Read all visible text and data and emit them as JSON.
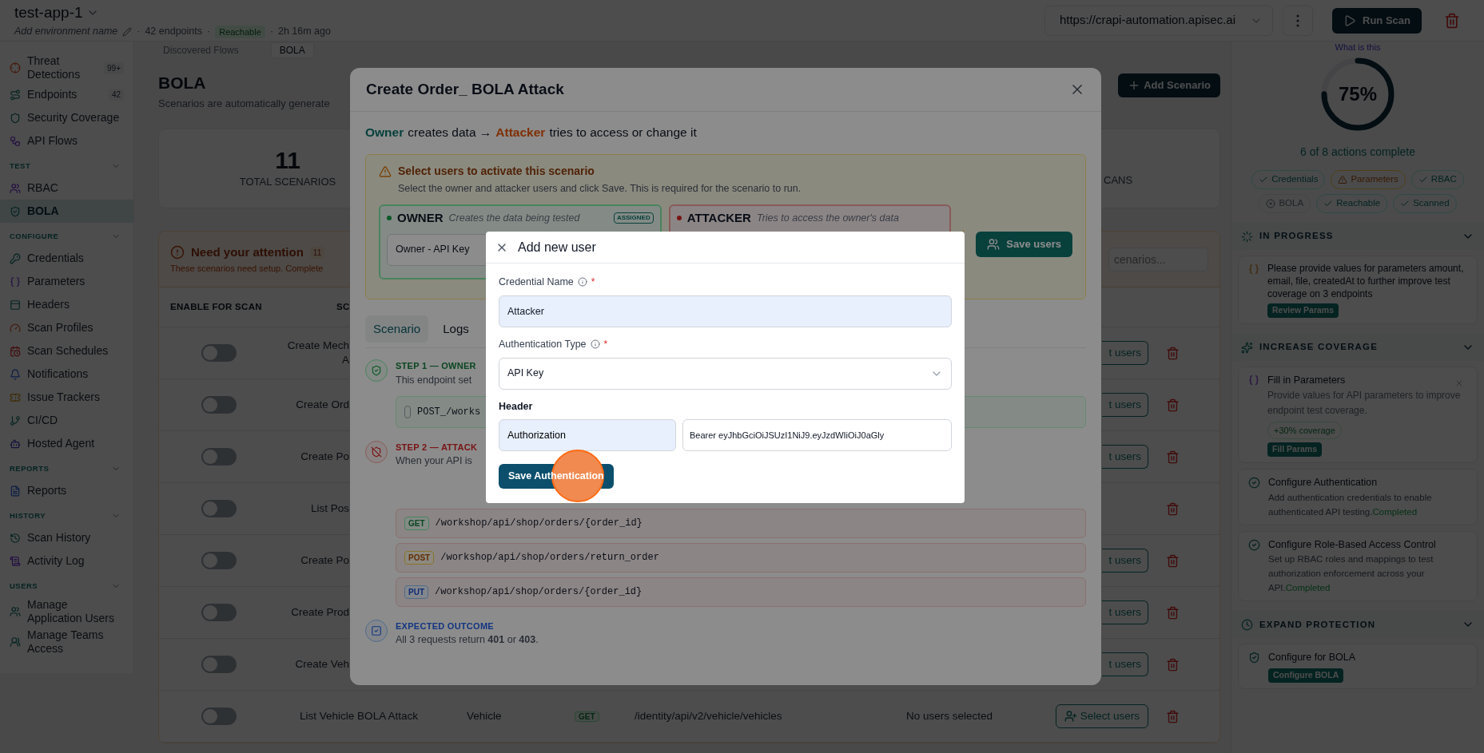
{
  "header": {
    "separator": "·",
    "app_name": "test-app-1",
    "env_placeholder": "Add environment name",
    "endpoints": "42 endpoints",
    "status": "Reachable",
    "updated": "2h 16m ago",
    "url": "https://crapi-automation.apisec.ai",
    "run_button": "Run Scan"
  },
  "sidebar": {
    "sections": [
      {
        "items": [
          {
            "label": "Threat Detections",
            "badge": "99+",
            "selected": false
          },
          {
            "label": "Endpoints",
            "badge": "42",
            "selected": false
          },
          {
            "label": "Security Coverage",
            "selected": false
          },
          {
            "label": "API Flows",
            "selected": false
          }
        ]
      },
      {
        "title": "TEST",
        "items": [
          {
            "label": "RBAC",
            "selected": false
          },
          {
            "label": "BOLA",
            "selected": true
          }
        ]
      },
      {
        "title": "CONFIGURE",
        "items": [
          {
            "label": "Credentials",
            "selected": false
          },
          {
            "label": "Parameters",
            "selected": false
          },
          {
            "label": "Headers",
            "selected": false
          },
          {
            "label": "Scan Profiles",
            "selected": false
          },
          {
            "label": "Scan Schedules",
            "selected": false
          },
          {
            "label": "Notifications",
            "selected": false
          },
          {
            "label": "Issue Trackers",
            "selected": false
          },
          {
            "label": "CI/CD",
            "selected": false
          },
          {
            "label": "Hosted Agent",
            "selected": false
          }
        ]
      },
      {
        "title": "REPORTS",
        "items": [
          {
            "label": "Reports",
            "selected": false
          }
        ]
      },
      {
        "title": "HISTORY",
        "items": [
          {
            "label": "Scan History",
            "selected": false
          },
          {
            "label": "Activity Log",
            "selected": false
          }
        ]
      },
      {
        "title": "USERS",
        "items": [
          {
            "label": "Manage Application Users",
            "selected": false
          },
          {
            "label": "Manage Teams Access",
            "selected": false
          }
        ]
      }
    ]
  },
  "page_tabs": [
    {
      "label": "Discovered Flows",
      "selected": false
    },
    {
      "label": "BOLA",
      "selected": true
    }
  ],
  "page": {
    "title": "BOLA",
    "subtitle": "Scenarios are automatically generate",
    "add_button": "Add Scenario",
    "stats": [
      {
        "value": "11",
        "label": "TOTAL SCENARIOS"
      },
      {
        "label": "CANS"
      }
    ]
  },
  "attention": {
    "title": "Need your attention",
    "count": "11",
    "text": "These scenarios need setup. Complete",
    "search_placeholder": "cenarios...",
    "columns": [
      "ENABLE FOR SCAN",
      "SC"
    ],
    "rows": [
      {
        "kind": "partial",
        "enabled": false,
        "name": [
          "Create Mech",
          "A"
        ],
        "select_users": "t users"
      },
      {
        "kind": "partial",
        "enabled": false,
        "name": [
          "Create Ord"
        ],
        "select_users": "t users"
      },
      {
        "kind": "partial",
        "enabled": false,
        "name": [
          "Create Po"
        ],
        "select_users": "t users"
      },
      {
        "kind": "partial",
        "enabled": false,
        "name": [
          "List Pos"
        ]
      },
      {
        "kind": "partial",
        "enabled": false,
        "name": [
          "Create Po"
        ],
        "select_users": "t users"
      },
      {
        "kind": "partial",
        "enabled": false,
        "name": [
          "Create Prod"
        ],
        "select_users": "t users"
      },
      {
        "kind": "partial",
        "enabled": false,
        "name": [
          "Create Veh"
        ],
        "select_users": "t users"
      },
      {
        "kind": "full",
        "enabled": false,
        "name": [
          "List Vehicle BOLA Attack"
        ],
        "category": "Vehicle",
        "method": "GET",
        "path": "/identity/api/v2/vehicle/vehicles",
        "users": "No users selected",
        "select_users": "Select users"
      }
    ]
  },
  "right_panel": {
    "help_link": "What is this",
    "progress": {
      "level": 0.75,
      "label": "75%",
      "caption": "6 of 8 actions complete"
    },
    "chips": [
      {
        "label": "Credentials",
        "kind": "done"
      },
      {
        "label": "Parameters",
        "kind": "warning"
      },
      {
        "label": "RBAC",
        "kind": "done"
      },
      {
        "label": "BOLA",
        "kind": "failed"
      },
      {
        "label": "Reachable",
        "kind": "done"
      },
      {
        "label": "Scanned",
        "kind": "done"
      }
    ],
    "sections": [
      {
        "title": "IN PROGRESS",
        "kind": "progress",
        "cards": [
          {
            "kind": "task",
            "text": "Please provide values for parameters amount, email, file, createdAt to further improve test coverage on 3 endpoints",
            "button": "Review Params"
          }
        ]
      },
      {
        "title": "INCREASE COVERAGE",
        "kind": "coverage",
        "cards": [
          {
            "kind": "suggestion",
            "title": "Fill in Parameters",
            "text": "Provide values for API parameters to improve endpoint test coverage.",
            "chip": "+30% coverage",
            "button": "Fill Params"
          },
          {
            "kind": "completed",
            "title": "Configure Authentication",
            "text": "Add authentication credentials to enable authenticated API testing.",
            "status": "Completed"
          },
          {
            "kind": "completed",
            "title": "Configure Role-Based Access Control",
            "text": "Set up RBAC roles and mappings to test authorization enforcement across your API.",
            "status": "Completed"
          }
        ]
      },
      {
        "title": "EXPAND PROTECTION",
        "kind": "expand",
        "cards": [
          {
            "kind": "action",
            "title": "Configure for BOLA",
            "button": "Configure BOLA"
          }
        ]
      }
    ]
  },
  "modal": {
    "title": "Create Order_ BOLA Attack",
    "flow": [
      {
        "text": "Owner",
        "kind": "owner"
      },
      {
        "text": "creates data →",
        "kind": "plain"
      },
      {
        "text": "Attacker",
        "kind": "attacker"
      },
      {
        "text": "tries to access or change it",
        "kind": "plain"
      }
    ],
    "alert": {
      "title": "Select users to activate this scenario",
      "text": "Select the owner and attacker users and click Save. This is required for the scenario to run."
    },
    "roles": [
      {
        "kind": "owner",
        "name": "OWNER",
        "hint": "Creates the data being tested",
        "badge": "ASSIGNED",
        "value": "Owner - API Key"
      },
      {
        "kind": "attacker",
        "name": "ATTACKER",
        "hint": "Tries to access the owner's data"
      }
    ],
    "save_users": "Save users",
    "tabs": [
      {
        "label": "Scenario",
        "selected": true
      },
      {
        "label": "Logs",
        "selected": false
      }
    ],
    "steps": [
      {
        "kind": "owner",
        "title": "STEP 1 — OWNER",
        "text": "This endpoint set",
        "requests": [
          {
            "path": "POST_/works"
          }
        ]
      },
      {
        "kind": "attacker",
        "title": "STEP 2 — ATTACK",
        "text": "When your API is",
        "requests": [
          {
            "method": "GET",
            "path": "/workshop/api/shop/orders/{order_id}"
          },
          {
            "method": "POST",
            "path": "/workshop/api/shop/orders/return_order"
          },
          {
            "method": "PUT",
            "path": "/workshop/api/shop/orders/{order_id}"
          }
        ]
      },
      {
        "kind": "outcome",
        "title": "EXPECTED OUTCOME",
        "text": "All 3 requests return **401** or **403**."
      }
    ]
  },
  "dialog": {
    "title": "Add new user",
    "fields": [
      {
        "kind": "text",
        "label": "Credential Name",
        "required_mark": "*",
        "value": "Attacker"
      },
      {
        "kind": "select",
        "label": "Authentication Type",
        "required_mark": "*",
        "value": "API Key"
      }
    ],
    "header_label": "Header",
    "header_name": "Authorization",
    "header_value": "Bearer eyJhbGciOiJSUzI1NiJ9.eyJzdWIiOiJ0aGly",
    "save_button": "Save Authentication"
  }
}
